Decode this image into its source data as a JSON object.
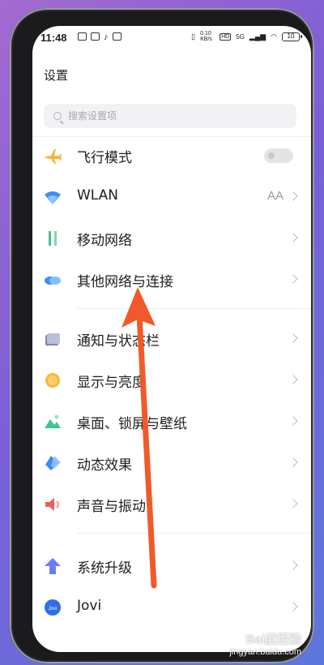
{
  "status_bar": {
    "time": "11:48",
    "net_speed": "0.10 KB/s",
    "hd": "HD",
    "signal": "5G",
    "battery": "10"
  },
  "header": {
    "title": "设置"
  },
  "search": {
    "placeholder": "搜索设置项"
  },
  "settings": {
    "items": [
      {
        "label": "飞行模式",
        "icon": "airplane-icon",
        "control": "toggle-off"
      },
      {
        "label": "WLAN",
        "icon": "wifi-icon",
        "value": "AA"
      },
      {
        "label": "移动网络",
        "icon": "mobile-data-icon"
      },
      {
        "label": "其他网络与连接",
        "icon": "cloud-link-icon"
      },
      {
        "label": "通知与状态栏",
        "icon": "notification-icon"
      },
      {
        "label": "显示与亮度",
        "icon": "brightness-icon"
      },
      {
        "label": "桌面、锁屏与壁纸",
        "icon": "wallpaper-icon"
      },
      {
        "label": "动态效果",
        "icon": "dynamic-effects-icon"
      },
      {
        "label": "声音与振动",
        "icon": "sound-icon"
      },
      {
        "label": "系统升级",
        "icon": "system-update-icon"
      },
      {
        "label": "Jovi",
        "icon": "jovi-icon"
      }
    ]
  },
  "watermark": {
    "logo": "Bai度经验",
    "site": "jingyan.baidu.com"
  },
  "colors": {
    "arrow": "#f05a2a",
    "accent_blue": "#3f8bf5"
  }
}
